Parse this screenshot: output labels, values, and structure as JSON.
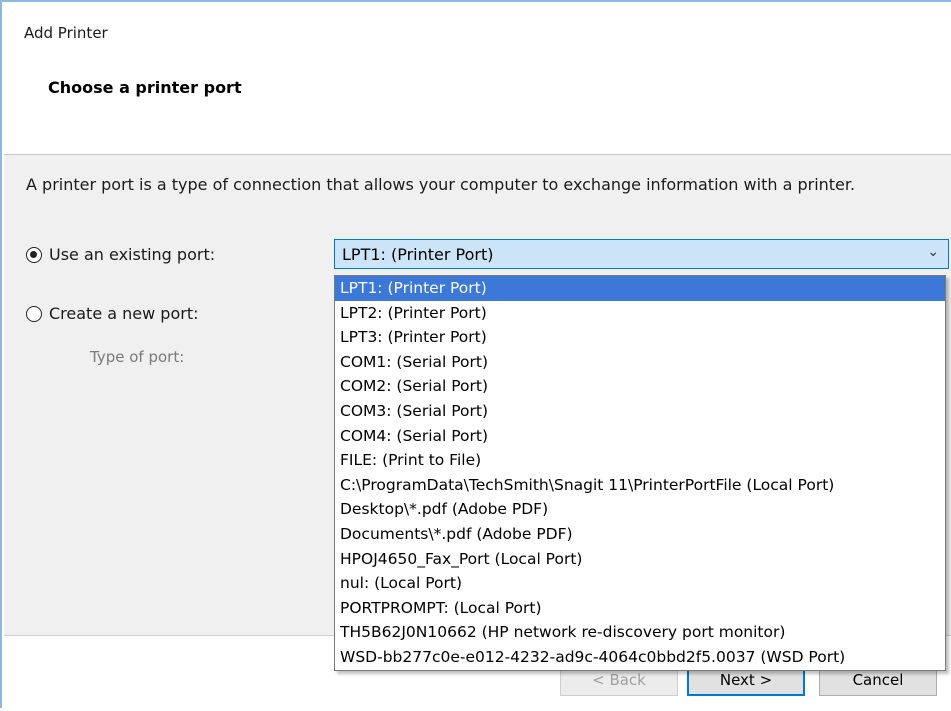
{
  "window": {
    "title": "Add Printer",
    "subtitle": "Choose a printer port"
  },
  "main": {
    "description": "A printer port is a type of connection that allows your computer to exchange information with a printer.",
    "use_existing_label": "Use an existing port:",
    "create_new_label": "Create a new port:",
    "type_of_port_label": "Type of port:",
    "port_select": {
      "selected_value": "LPT1: (Printer Port)",
      "options": [
        "LPT1: (Printer Port)",
        "LPT2: (Printer Port)",
        "LPT3: (Printer Port)",
        "COM1: (Serial Port)",
        "COM2: (Serial Port)",
        "COM3: (Serial Port)",
        "COM4: (Serial Port)",
        "FILE: (Print to File)",
        "C:\\ProgramData\\TechSmith\\Snagit 11\\PrinterPortFile (Local Port)",
        "Desktop\\*.pdf (Adobe PDF)",
        "Documents\\*.pdf (Adobe PDF)",
        "HPOJ4650_Fax_Port (Local Port)",
        "nul: (Local Port)",
        "PORTPROMPT: (Local Port)",
        "TH5B62J0N10662 (HP network re-discovery port monitor)",
        "WSD-bb277c0e-e012-4232-ad9c-4064c0bbd2f5.0037 (WSD Port)"
      ]
    }
  },
  "footer": {
    "back_label": "< Back",
    "next_label": "Next >",
    "cancel_label": "Cancel"
  },
  "colors": {
    "accent": "#0078d7",
    "selection": "#3c78d8",
    "combo_background": "#cce4f7"
  }
}
